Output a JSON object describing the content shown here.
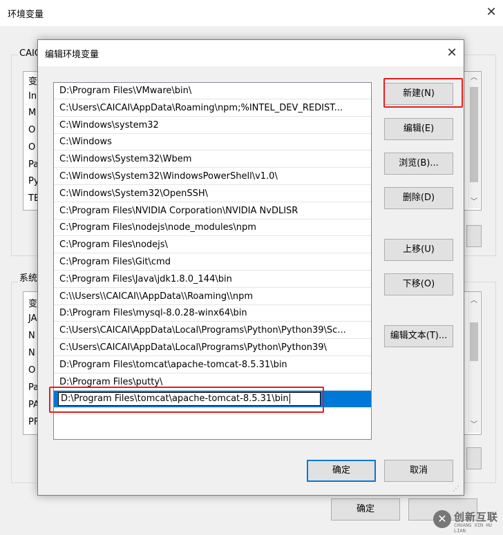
{
  "background_window": {
    "title": "环境变量",
    "user_group_label": "CAIC",
    "user_rows": [
      "变",
      "In",
      "M",
      "O",
      "O",
      "Pa",
      "Py",
      "TE"
    ],
    "system_group_label": "系统",
    "system_rows": [
      "变",
      "JA",
      "N",
      "N",
      "O",
      "Pa",
      "PA",
      "PF"
    ],
    "ok_label": "确定"
  },
  "dialog": {
    "title": "编辑环境变量",
    "paths": [
      "D:\\Program Files\\VMware\\bin\\",
      "C:\\Users\\CAICAI\\AppData\\Roaming\\npm;%INTEL_DEV_REDIST...",
      "C:\\Windows\\system32",
      "C:\\Windows",
      "C:\\Windows\\System32\\Wbem",
      "C:\\Windows\\System32\\WindowsPowerShell\\v1.0\\",
      "C:\\Windows\\System32\\OpenSSH\\",
      "C:\\Program Files\\NVIDIA Corporation\\NVIDIA NvDLISR",
      "C:\\Program Files\\nodejs\\node_modules\\npm",
      "C:\\Program Files\\nodejs\\",
      "C:\\Program Files\\Git\\cmd",
      "C:\\Program Files\\Java\\jdk1.8.0_144\\bin",
      "C:\\\\Users\\\\CAICAI\\\\AppData\\\\Roaming\\\\npm",
      "D:\\Program Files\\mysql-8.0.28-winx64\\bin",
      "C:\\Users\\CAICAI\\AppData\\Local\\Programs\\Python\\Python39\\Sc...",
      "C:\\Users\\CAICAI\\AppData\\Local\\Programs\\Python\\Python39\\",
      "D:\\Program Files\\tomcat\\apache-tomcat-8.5.31\\bin",
      "D:\\Program Files\\putty\\"
    ],
    "editing_value": "D:\\Program Files\\tomcat\\apache-tomcat-8.5.31\\bin",
    "buttons": {
      "new": "新建(N)",
      "edit": "编辑(E)",
      "browse": "浏览(B)...",
      "delete": "删除(D)",
      "move_up": "上移(U)",
      "move_down": "下移(O)",
      "edit_text": "编辑文本(T)...",
      "ok": "确定",
      "cancel": "取消"
    }
  },
  "watermark": {
    "brand": "创新互联",
    "sub": "CHUANG XIN HU LIAN"
  },
  "colors": {
    "highlight": "#e81b1b",
    "selection": "#0078d7"
  }
}
